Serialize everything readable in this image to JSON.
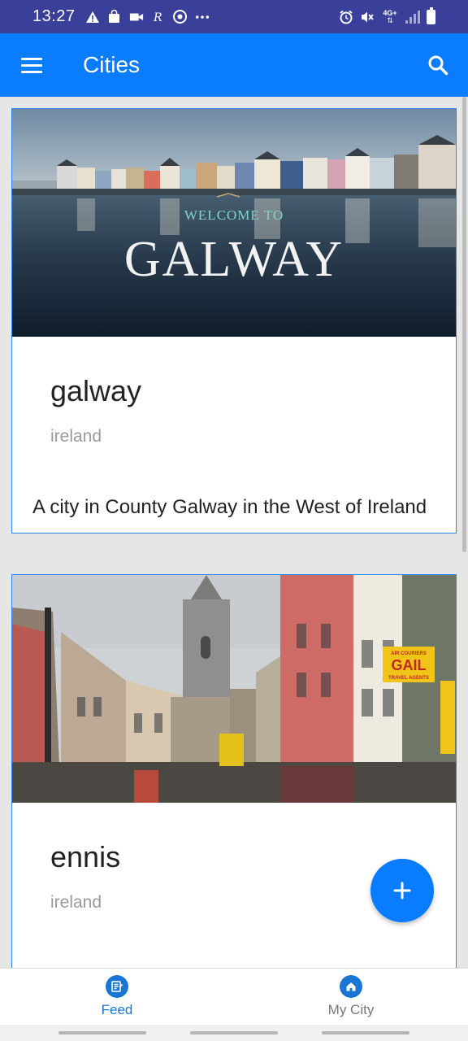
{
  "status_bar": {
    "time": "13:27",
    "left_icons": [
      "warning-icon",
      "shopping-bag-icon",
      "video-icon",
      "r-app-icon",
      "chrome-icon",
      "more-dots-icon"
    ],
    "network_label": "4G+",
    "right_icons": [
      "alarm-icon",
      "mute-icon",
      "network-icon",
      "signal-icon",
      "battery-icon"
    ]
  },
  "app_bar": {
    "title": "Cities",
    "menu_icon": "hamburger-menu-icon",
    "search_icon": "search-icon"
  },
  "cards": [
    {
      "image_text_top": "WELCOME TO",
      "image_text_main": "GALWAY",
      "title": "galway",
      "country": "ireland",
      "description": "A city in County Galway in the West of Ireland"
    },
    {
      "image_text_sign": "GAIL",
      "image_text_sign_top": "AIR COURIERS",
      "image_text_sign_bottom": "TRAVEL AGENTS",
      "title": "ennis",
      "country": "ireland"
    }
  ],
  "fab": {
    "icon": "plus-icon"
  },
  "bottom_nav": {
    "items": [
      {
        "label": "Feed",
        "icon": "feed-icon",
        "active": true
      },
      {
        "label": "My City",
        "icon": "home-icon",
        "active": false
      }
    ]
  },
  "colors": {
    "status_bar": "#3a3f99",
    "primary": "#0a7cff",
    "active_nav": "#1976d2",
    "inactive_nav": "#777777"
  }
}
